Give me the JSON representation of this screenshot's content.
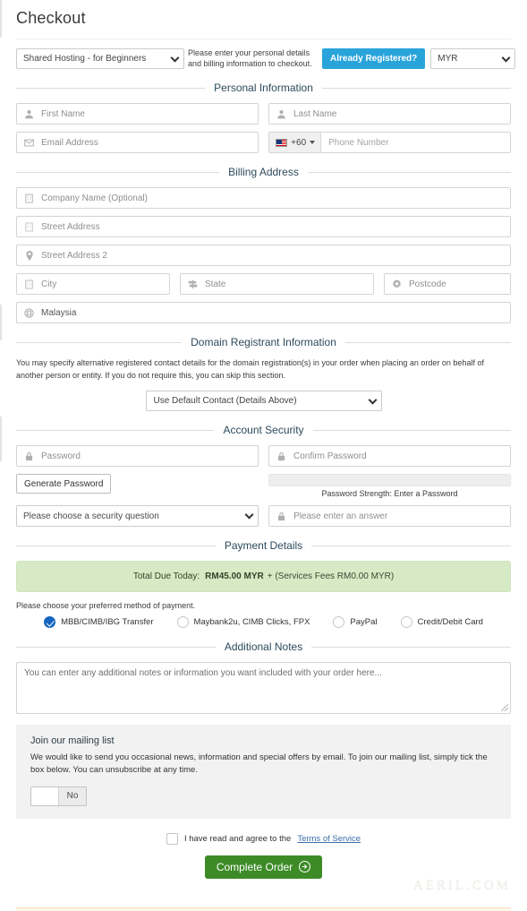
{
  "page": {
    "title": "Checkout",
    "watermark": "AERIL.COM"
  },
  "topbar": {
    "product": "Shared Hosting - for Beginners",
    "note": "Please enter your personal details and billing information to checkout.",
    "already_registered_label": "Already Registered?",
    "currency": "MYR"
  },
  "sections": {
    "personal_information": "Personal Information",
    "billing_address": "Billing Address",
    "domain_registrant": "Domain Registrant Information",
    "account_security": "Account Security",
    "payment_details": "Payment Details",
    "additional_notes": "Additional Notes"
  },
  "personal": {
    "first_name_placeholder": "First Name",
    "last_name_placeholder": "Last Name",
    "email_placeholder": "Email Address",
    "phone_prefix": "+60",
    "phone_placeholder": "Phone Number"
  },
  "billing": {
    "company_placeholder": "Company Name (Optional)",
    "street_placeholder": "Street Address",
    "street2_placeholder": "Street Address 2",
    "city_placeholder": "City",
    "state_placeholder": "State",
    "postcode_placeholder": "Postcode",
    "country": "Malaysia"
  },
  "registrant": {
    "description": "You may specify alternative registered contact details for the domain registration(s) in your order when placing an order on behalf of another person or entity. If you do not require this, you can skip this section.",
    "contact_select": "Use Default Contact (Details Above)"
  },
  "security": {
    "password_placeholder": "Password",
    "confirm_password_placeholder": "Confirm Password",
    "generate_password_label": "Generate Password",
    "strength_text": "Password Strength: Enter a Password",
    "security_question": "Please choose a security question",
    "security_answer_placeholder": "Please enter an answer"
  },
  "payment": {
    "total_label": "Total Due Today:",
    "total_amount": "RM45.00 MYR",
    "fees_text": "+ (Services Fees RM0.00 MYR)",
    "prompt": "Please choose your preferred method of payment.",
    "methods": [
      {
        "label": "MBB/CIMB/IBG Transfer",
        "selected": true
      },
      {
        "label": "Maybank2u, CIMB Clicks, FPX",
        "selected": false
      },
      {
        "label": "PayPal",
        "selected": false
      },
      {
        "label": "Credit/Debit Card",
        "selected": false
      }
    ]
  },
  "notes": {
    "placeholder": "You can enter any additional notes or information you want included with your order here..."
  },
  "mailing": {
    "title": "Join our mailing list",
    "text": "We would like to send you occasional news, information and special offers by email. To join our mailing list, simply tick the box below. You can unsubscribe at any time.",
    "toggle_value": "No"
  },
  "terms": {
    "text": "I have read and agree to the",
    "link": "Terms of Service",
    "checked": false
  },
  "submit": {
    "label": "Complete Order"
  },
  "colors": {
    "accent_blue": "#29a4db",
    "section_heading": "#2d4a5c",
    "total_banner_bg": "#d6eac6",
    "submit_green": "#3d8b27",
    "radio_selected": "#1565c0",
    "link_blue": "#3b6ea8"
  }
}
